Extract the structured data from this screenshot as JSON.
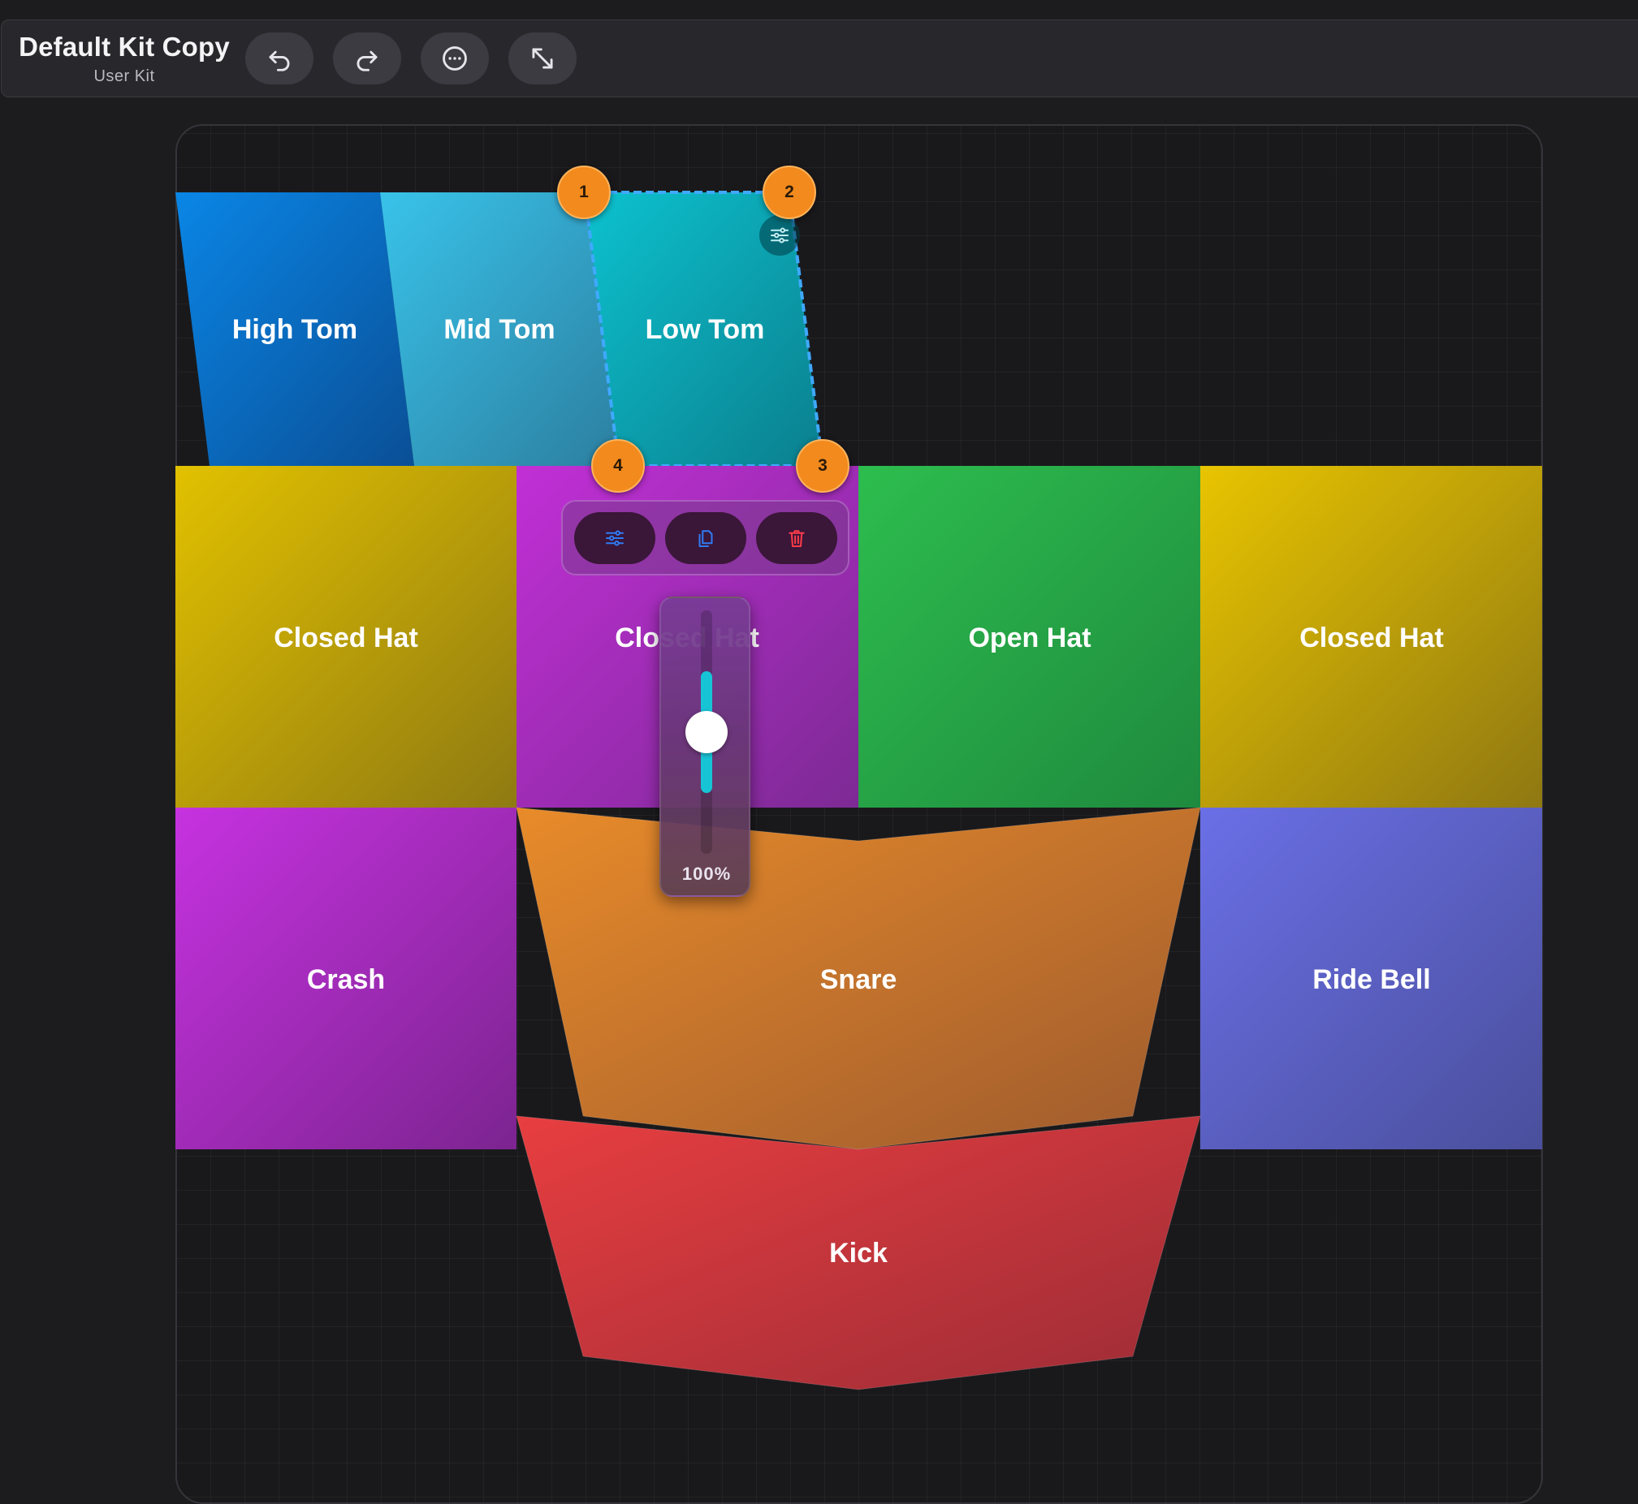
{
  "header": {
    "title": "Default Kit Copy",
    "subtitle": "User Kit",
    "buttons": [
      {
        "name": "undo-button",
        "icon": "undo-icon"
      },
      {
        "name": "redo-button",
        "icon": "redo-icon"
      },
      {
        "name": "more-button",
        "icon": "more-options-icon"
      },
      {
        "name": "fullscreen-button",
        "icon": "expand-icon"
      }
    ]
  },
  "pads": [
    {
      "id": "high-tom",
      "label": "High Tom",
      "colors": [
        "#0a86e6",
        "#0a4f96"
      ]
    },
    {
      "id": "mid-tom",
      "label": "Mid Tom",
      "colors": [
        "#39c3ea",
        "#2c7fa0"
      ]
    },
    {
      "id": "low-tom",
      "label": "Low Tom",
      "colors": [
        "#0cc2cf",
        "#0b7f8e"
      ],
      "selected": true
    },
    {
      "id": "closed-hat-left",
      "label": "Closed Hat",
      "colors": [
        "#e2c100",
        "#8f7a12"
      ]
    },
    {
      "id": "closed-hat-selected",
      "label": "Closed Hat",
      "colors": [
        "#c12fd6",
        "#7d2a95"
      ]
    },
    {
      "id": "open-hat",
      "label": "Open Hat",
      "colors": [
        "#2dbd4e",
        "#1f8a3e"
      ]
    },
    {
      "id": "closed-hat-right",
      "label": "Closed Hat",
      "colors": [
        "#e8c400",
        "#8f7812"
      ]
    },
    {
      "id": "crash",
      "label": "Crash",
      "colors": [
        "#c632e0",
        "#7c2490"
      ]
    },
    {
      "id": "snare",
      "label": "Snare",
      "colors": [
        "#e88b2a",
        "#9d5a2e"
      ]
    },
    {
      "id": "ride-bell",
      "label": "Ride Bell",
      "colors": [
        "#6a6fe6",
        "#4a4f9c"
      ]
    },
    {
      "id": "kick",
      "label": "Kick",
      "colors": [
        "#e83e40",
        "#9c2c36"
      ]
    }
  ],
  "handles": [
    "1",
    "2",
    "3",
    "4"
  ],
  "action_bar": [
    {
      "name": "pad-settings-button",
      "icon": "sliders-icon",
      "color": "#2f7bf5"
    },
    {
      "name": "duplicate-pad-button",
      "icon": "duplicate-icon",
      "color": "#2f7bf5"
    },
    {
      "name": "delete-pad-button",
      "icon": "trash-icon",
      "color": "#ff3b4a"
    }
  ],
  "volume": {
    "value": 1.0,
    "label": "100%"
  }
}
